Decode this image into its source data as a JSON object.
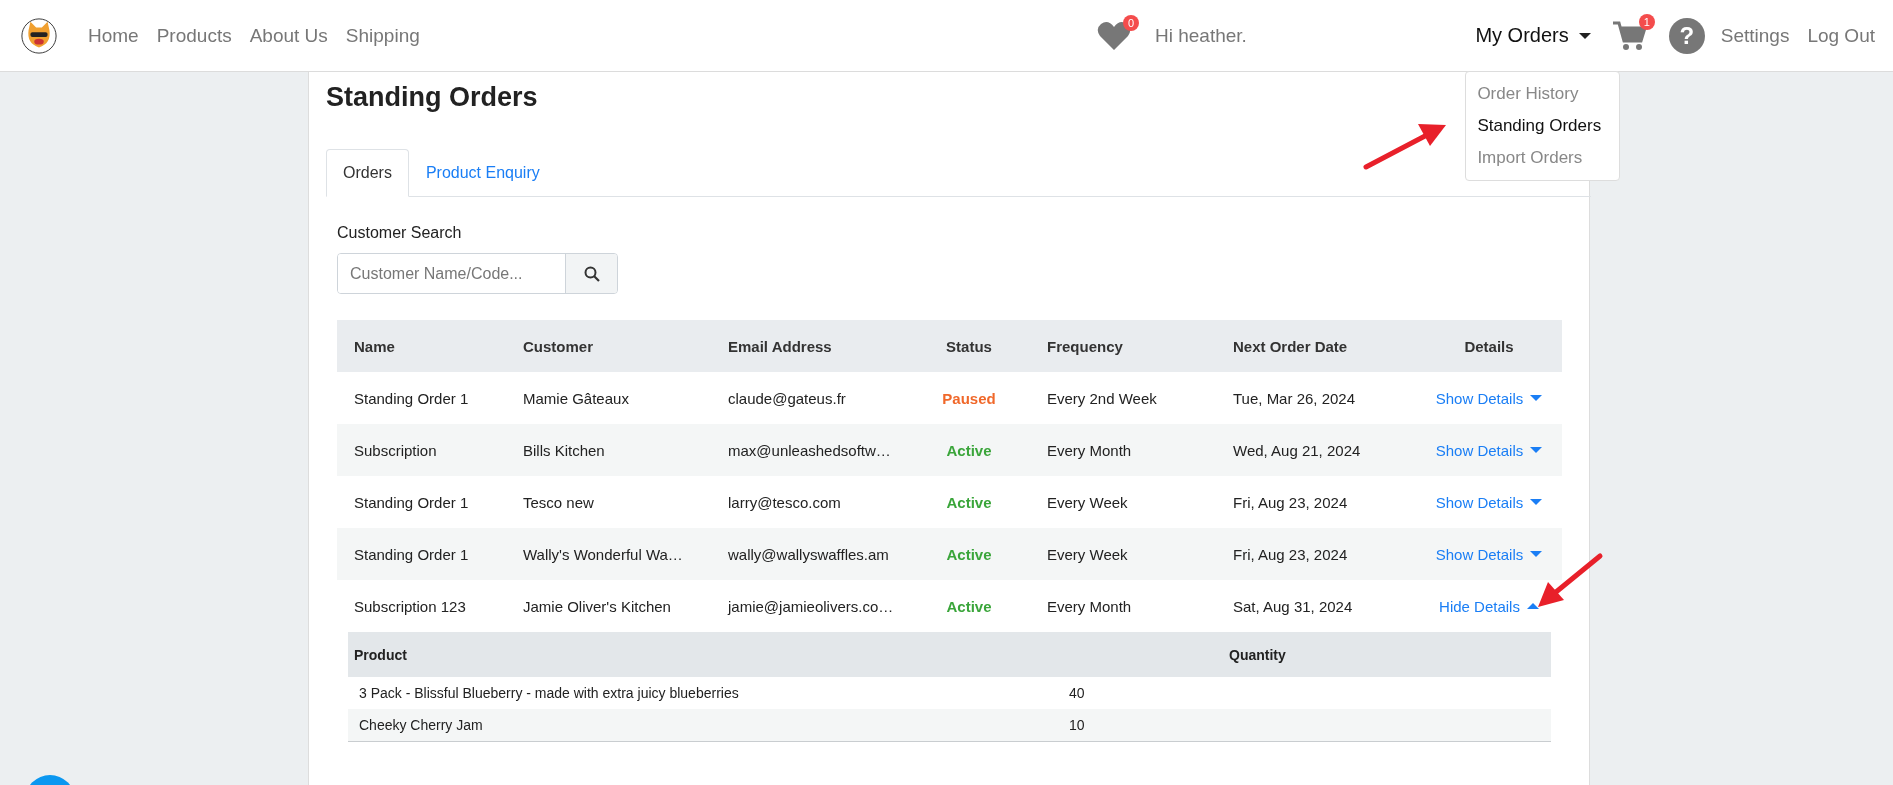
{
  "nav": {
    "links": [
      "Home",
      "Products",
      "About Us",
      "Shipping"
    ]
  },
  "wishlist": {
    "count": "0"
  },
  "greeting": "Hi heather.",
  "account_menu": {
    "label": "My Orders",
    "items": [
      {
        "label": "Order History",
        "selected": false
      },
      {
        "label": "Standing Orders",
        "selected": true
      },
      {
        "label": "Import Orders",
        "selected": false
      }
    ]
  },
  "cart": {
    "count": "1"
  },
  "help": "?",
  "settings": "Settings",
  "logout": "Log Out",
  "page_title": "Standing Orders",
  "tabs": [
    {
      "label": "Orders",
      "selected": true
    },
    {
      "label": "Product Enquiry",
      "selected": false
    }
  ],
  "search": {
    "label": "Customer Search",
    "placeholder": "Customer Name/Code..."
  },
  "table": {
    "columns": [
      "Name",
      "Customer",
      "Email Address",
      "Status",
      "Frequency",
      "Next Order Date",
      "Details"
    ],
    "rows": [
      {
        "name": "Standing Order 1",
        "customer": "Mamie Gâteaux",
        "email": "claude@gateus.fr",
        "status": {
          "text": "Paused",
          "kind": "paused"
        },
        "frequency": "Every 2nd Week",
        "next_order_date": "Tue, Mar 26, 2024",
        "details": {
          "label": "Show Details",
          "expanded": false
        }
      },
      {
        "name": "Subscription",
        "customer": "Bills Kitchen",
        "email": "max@unleashedsoftw…",
        "status": {
          "text": "Active",
          "kind": "active"
        },
        "frequency": "Every Month",
        "next_order_date": "Wed, Aug 21, 2024",
        "details": {
          "label": "Show Details",
          "expanded": false
        }
      },
      {
        "name": "Standing Order 1",
        "customer": "Tesco new",
        "email": "larry@tesco.com",
        "status": {
          "text": "Active",
          "kind": "active"
        },
        "frequency": "Every Week",
        "next_order_date": "Fri, Aug 23, 2024",
        "details": {
          "label": "Show Details",
          "expanded": false
        }
      },
      {
        "name": "Standing Order 1",
        "customer": "Wally's Wonderful Wa…",
        "email": "wally@wallyswaffles.am",
        "status": {
          "text": "Active",
          "kind": "active"
        },
        "frequency": "Every Week",
        "next_order_date": "Fri, Aug 23, 2024",
        "details": {
          "label": "Show Details",
          "expanded": false
        }
      },
      {
        "name": "Subscription 123",
        "customer": "Jamie Oliver's Kitchen",
        "email": "jamie@jamieolivers.co…",
        "status": {
          "text": "Active",
          "kind": "active"
        },
        "frequency": "Every Month",
        "next_order_date": "Sat, Aug 31, 2024",
        "details": {
          "label": "Hide Details",
          "expanded": true
        }
      }
    ]
  },
  "order_details": {
    "columns": [
      "Product",
      "Quantity"
    ],
    "rows": [
      {
        "product": "3 Pack - Blissful Blueberry - made with extra juicy blueberries",
        "quantity": "40"
      },
      {
        "product": "Cheeky Cherry Jam",
        "quantity": "10"
      }
    ]
  }
}
